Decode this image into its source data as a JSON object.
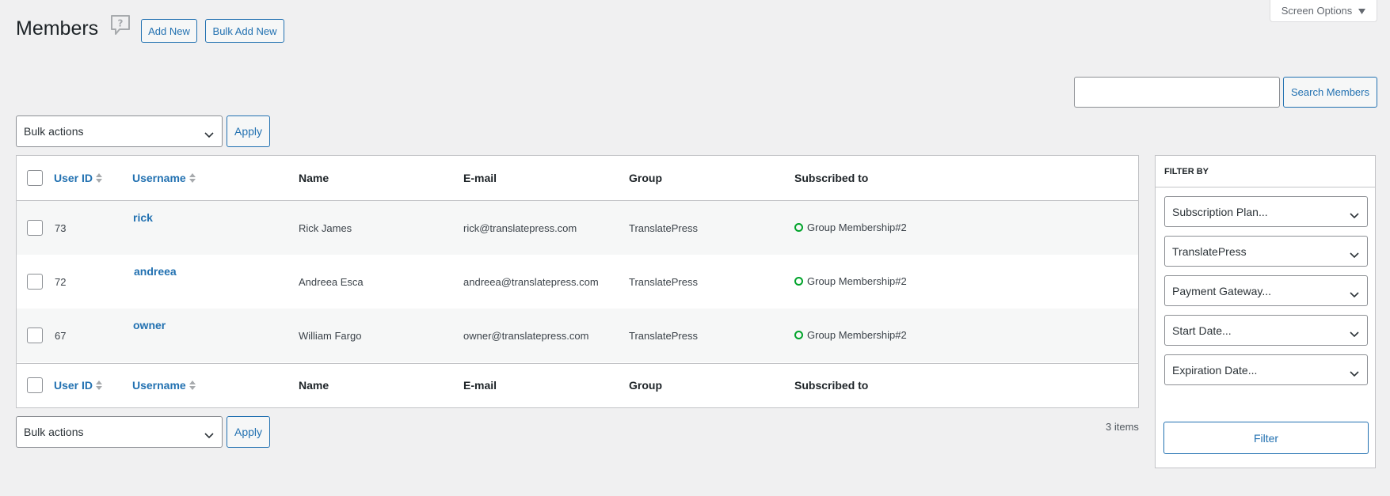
{
  "header": {
    "title": "Members",
    "add_new": "Add New",
    "bulk_add_new": "Bulk Add New",
    "screen_options": "Screen Options"
  },
  "search": {
    "value": "",
    "button": "Search Members"
  },
  "bulk": {
    "top_select": "Bulk actions",
    "top_apply": "Apply",
    "bottom_select": "Bulk actions",
    "bottom_apply": "Apply"
  },
  "table": {
    "columns": [
      "User ID",
      "Username",
      "Name",
      "E-mail",
      "Group",
      "Subscribed to"
    ],
    "rows": [
      {
        "id": "73",
        "username": "rick",
        "name": "Rick James",
        "email": "rick@translatepress.com",
        "group": "TranslatePress",
        "subscribed": "Group Membership#2"
      },
      {
        "id": "72",
        "username": "andreea",
        "name": "Andreea Esca",
        "email": "andreea@translatepress.com",
        "group": "TranslatePress",
        "subscribed": "Group Membership#2"
      },
      {
        "id": "67",
        "username": "owner",
        "name": "William Fargo",
        "email": "owner@translatepress.com",
        "group": "TranslatePress",
        "subscribed": "Group Membership#2"
      }
    ],
    "items_count": "3 items"
  },
  "filter": {
    "title": "FILTER BY",
    "selects": [
      "Subscription Plan...",
      "TranslatePress",
      "Payment Gateway...",
      "Start Date...",
      "Expiration Date..."
    ],
    "button": "Filter"
  },
  "colors": {
    "accent": "#2271b1",
    "active_status": "#00a32a",
    "background": "#f0f0f1"
  },
  "icons": {
    "help": "help-speech-bubble-icon",
    "screen_options_arrow": "triangle-down-icon",
    "select_chevron": "chevron-down-icon",
    "sort": "sort-arrows-icon",
    "status": "active-status-circle-icon"
  }
}
